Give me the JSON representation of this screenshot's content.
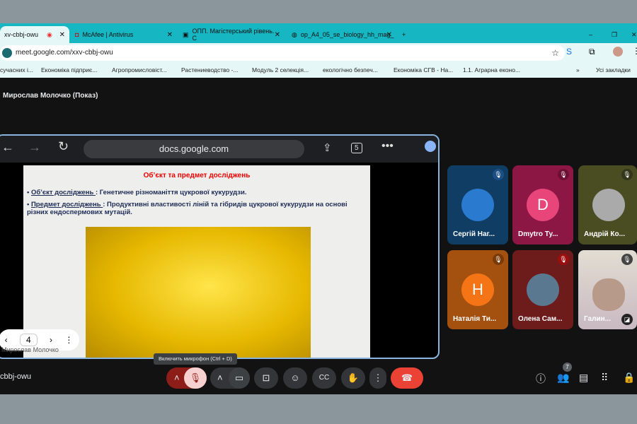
{
  "browser": {
    "tabs": [
      {
        "label": "xv-cbbj-owu",
        "active": true
      },
      {
        "label": "McAfee | Antivirus"
      },
      {
        "label": "ОПП. Магістерський рівень. С"
      },
      {
        "label": "op_A4_05_se_biology_hh_mag_"
      }
    ],
    "new_tab": "+",
    "url": "meet.google.com/xxv-cbbj-owu",
    "bookmarks": [
      "сучасних і...",
      "Економіка підприє...",
      "Агропромисловіст...",
      "Растениеводство -...",
      "Модуль 2 селекція...",
      "екологічно безпеч...",
      "Економіка СГВ - На...",
      "1.1. Аграрна еконо..."
    ],
    "all_bookmarks": "Усі закладки",
    "more": "»"
  },
  "meet": {
    "presenter": "Мирослав Молочко (Показ)",
    "shared": {
      "domain": "docs.google.com",
      "tab_count": "5",
      "page": "4",
      "overlay_name": "Мирослав Молочко",
      "slide": {
        "title": "Об’єкт та предмет досліджень",
        "bullets": [
          {
            "label": "Об’єкт досліджень ",
            "text": ": Генетичне різноманіття цукрової кукурудзи."
          },
          {
            "label": "Предмет досліджень ",
            "text": ": Продуктивні властивості ліній та гібридів цукрової кукурудзи на основі різних ендоспермових мутацій."
          }
        ]
      }
    },
    "participants": [
      {
        "name": "Сергій Наг...",
        "bg": "#0f3d63",
        "avatar": "photo"
      },
      {
        "name": "Dmytro Ту...",
        "bg": "#8c1744",
        "initial": "D",
        "avatar_color": "#e8457a"
      },
      {
        "name": "Андрій Ко...",
        "bg": "#4a4d22",
        "avatar": "photo"
      },
      {
        "name": "Наталія Ти...",
        "bg": "#a4500e",
        "initial": "H",
        "avatar_color": "#f57516"
      },
      {
        "name": "Олена Сам...",
        "bg": "#6e1b1b",
        "avatar": "photo"
      },
      {
        "name": "Галин...",
        "bg": "#d9d2c7",
        "avatar": "video"
      }
    ],
    "meeting_code": "cbbj-owu",
    "tooltip": "Включить микрофон (Ctrl + D)",
    "people_count": "7",
    "end_call_color": "#ea4335"
  }
}
